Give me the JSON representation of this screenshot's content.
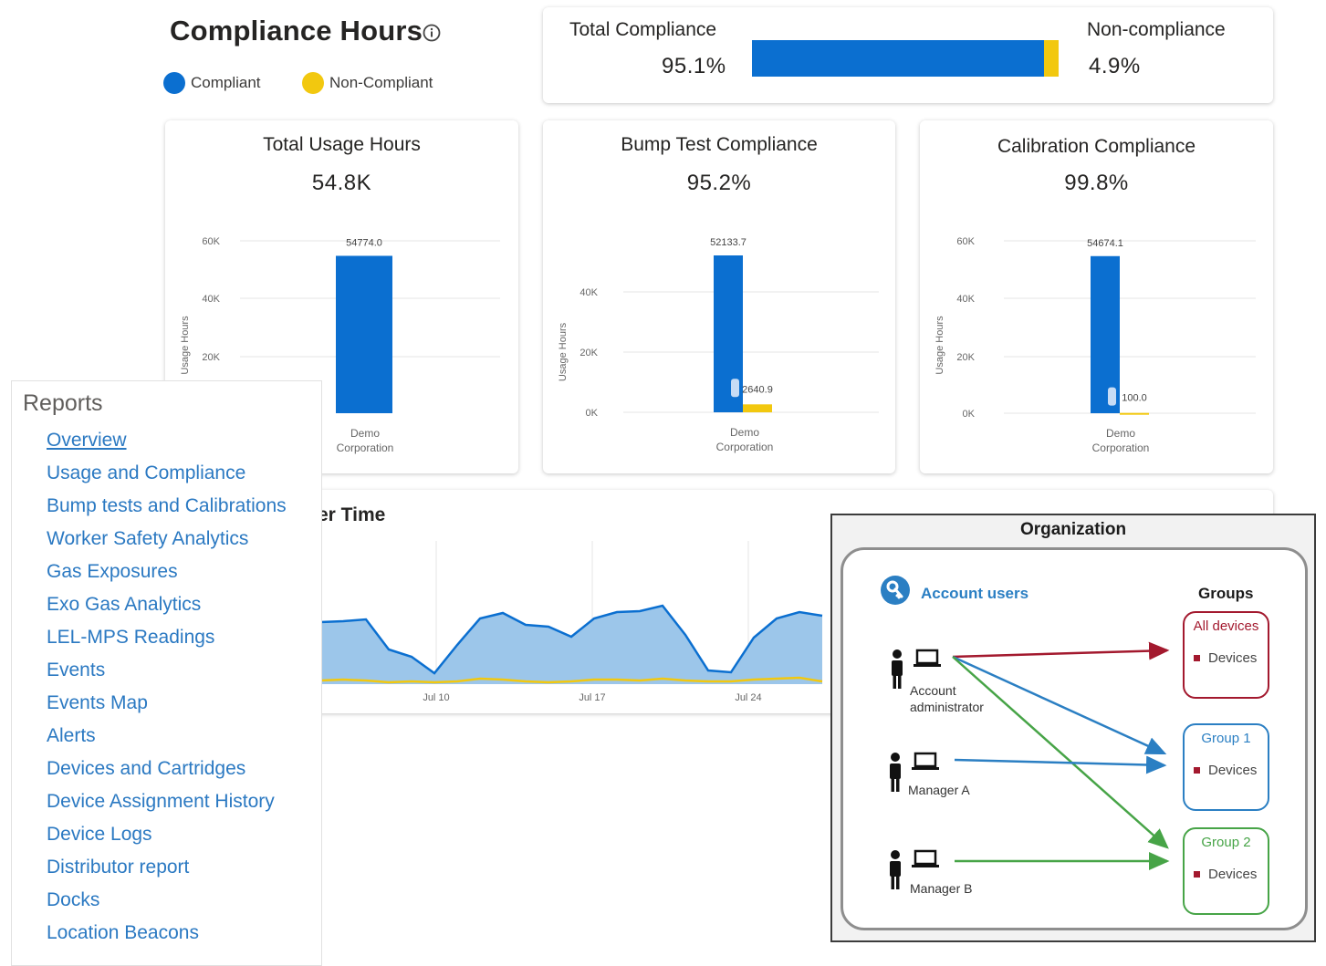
{
  "header": {
    "title": "Compliance Hours",
    "legend": [
      {
        "label": "Compliant",
        "color": "#0b6fd0"
      },
      {
        "label": "Non-Compliant",
        "color": "#f2c80f"
      }
    ]
  },
  "summary": {
    "total_label": "Total Compliance",
    "total_value": "95.1%",
    "non_label": "Non-compliance",
    "non_value": "4.9%",
    "compliant_fraction": 0.951,
    "non_fraction": 0.049
  },
  "colors": {
    "compliant": "#0b6fd0",
    "noncompliant": "#f2c80f",
    "tooltip": "#c7dcf5"
  },
  "cards": [
    {
      "title": "Total Usage Hours",
      "value": "54.8K"
    },
    {
      "title": "Bump Test Compliance",
      "value": "95.2%"
    },
    {
      "title": "Calibration Compliance",
      "value": "99.8%"
    }
  ],
  "chart_data": [
    {
      "type": "bar",
      "ylabel": "Usage Hours",
      "ylim": [
        0,
        60000
      ],
      "yticks": [
        "60K",
        "40K",
        "20K"
      ],
      "categories": [
        "Demo Corporation"
      ],
      "series": [
        {
          "values": [
            54774.0
          ]
        }
      ],
      "data_labels": [
        "54774.0"
      ],
      "grid": true
    },
    {
      "type": "bar",
      "ylabel": "Usage Hours",
      "ylim": [
        0,
        52133.7
      ],
      "yticks": [
        "40K",
        "20K",
        "0K"
      ],
      "categories": [
        "Demo Corporation"
      ],
      "series": [
        {
          "values": [
            52133.7
          ]
        },
        {
          "values": [
            2640.9
          ]
        }
      ],
      "data_labels": [
        "52133.7",
        "2640.9"
      ],
      "grid": true
    },
    {
      "type": "bar",
      "ylabel": "Usage Hours",
      "ylim": [
        0,
        60000
      ],
      "yticks": [
        "60K",
        "40K",
        "20K",
        "0K"
      ],
      "categories": [
        "Demo Corporation"
      ],
      "series": [
        {
          "values": [
            54674.1
          ]
        },
        {
          "values": [
            100.0
          ]
        }
      ],
      "data_labels": [
        "54674.1",
        "100.0"
      ],
      "grid": true
    },
    {
      "type": "area",
      "x_labels": [
        "Jul 10",
        "Jul 17",
        "Jul 24"
      ],
      "series": [
        {
          "values": [
            0.68,
            0.69,
            0.71,
            0.38,
            0.3,
            0.12,
            0.43,
            0.72,
            0.78,
            0.65,
            0.63,
            0.52,
            0.72,
            0.79,
            0.8,
            0.86,
            0.54,
            0.15,
            0.13,
            0.51,
            0.72,
            0.79,
            0.75
          ]
        },
        {
          "values": [
            0.04,
            0.05,
            0.04,
            0.02,
            0.03,
            0.02,
            0.03,
            0.06,
            0.05,
            0.03,
            0.02,
            0.03,
            0.05,
            0.05,
            0.04,
            0.06,
            0.04,
            0.03,
            0.03,
            0.05,
            0.06,
            0.07,
            0.03
          ]
        }
      ],
      "grid": true
    }
  ],
  "trend": {
    "title_fragment": "er Time"
  },
  "reports": {
    "title": "Reports",
    "items": [
      "Overview",
      "Usage and Compliance",
      "Bump tests and Calibrations",
      "Worker Safety Analytics",
      "Gas Exposures",
      "Exo Gas Analytics",
      "LEL-MPS Readings",
      "Events",
      "Events Map",
      "Alerts",
      "Devices and Cartridges",
      "Device Assignment History",
      "Device Logs",
      "Distributor report",
      "Docks",
      "Location Beacons"
    ]
  },
  "org": {
    "title": "Organization",
    "account_users": "Account users",
    "groups_label": "Groups",
    "roles": [
      {
        "label": "Account administrator"
      },
      {
        "label": "Manager A"
      },
      {
        "label": "Manager B"
      }
    ],
    "groups": [
      {
        "title": "All devices",
        "item": "Devices",
        "color": "#a3192e"
      },
      {
        "title": "Group 1",
        "item": "Devices",
        "color": "#2b7fc3"
      },
      {
        "title": "Group 2",
        "item": "Devices",
        "color": "#47a447"
      }
    ]
  }
}
